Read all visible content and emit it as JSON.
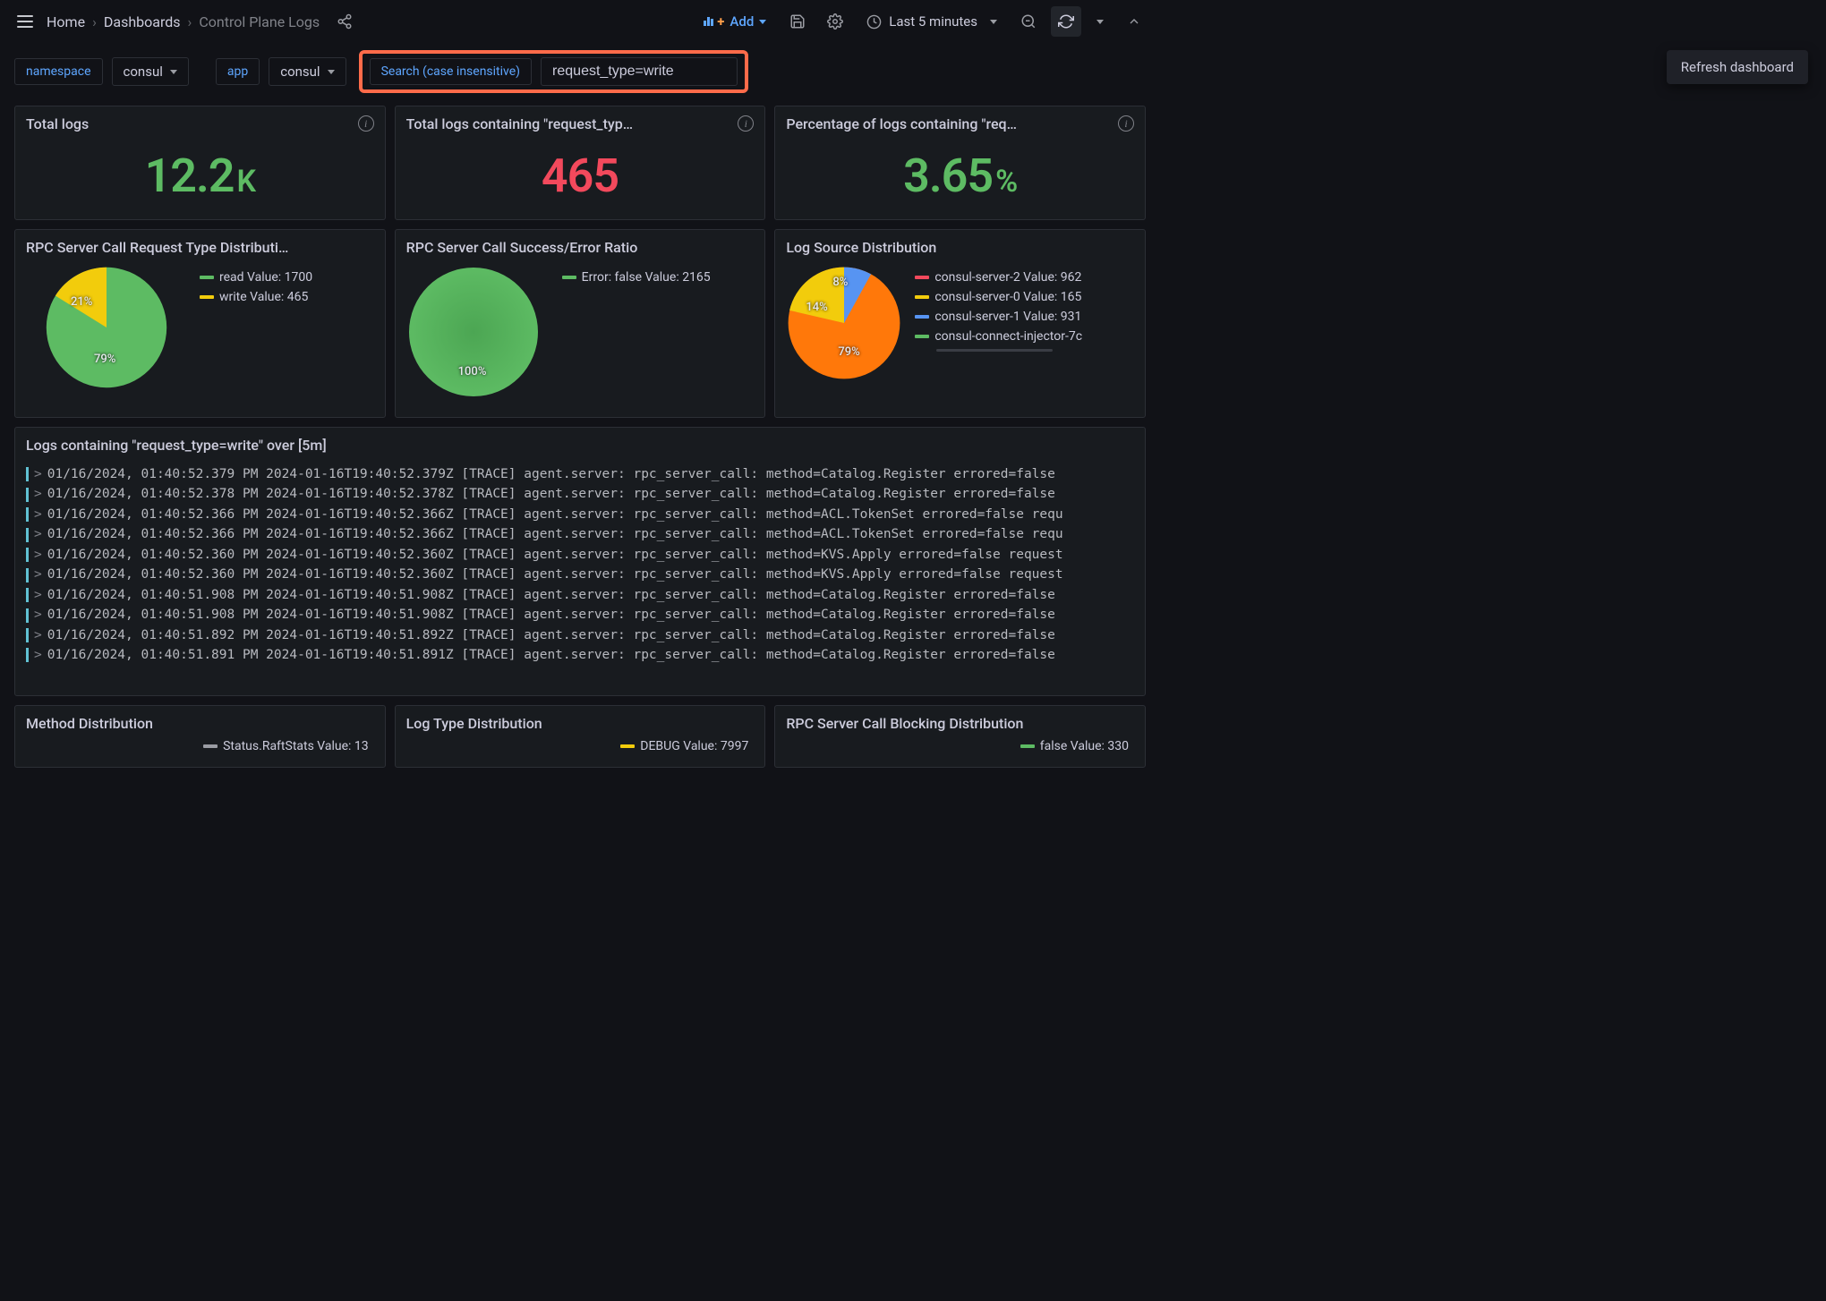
{
  "toolbar": {
    "breadcrumbs": [
      "Home",
      "Dashboards",
      "Control Plane Logs"
    ],
    "add_label": "Add",
    "time_label": "Last 5 minutes",
    "tooltip": "Refresh dashboard"
  },
  "filters": {
    "namespace_label": "namespace",
    "namespace_value": "consul",
    "app_label": "app",
    "app_value": "consul",
    "search_label": "Search (case insensitive)",
    "search_value": "request_type=write"
  },
  "panels": {
    "total_logs": {
      "title": "Total logs",
      "value": "12.2",
      "unit": "K"
    },
    "total_match": {
      "title": "Total logs containing \"request_typ…",
      "value": "465"
    },
    "percent_match": {
      "title": "Percentage of logs containing \"req…",
      "value": "3.65",
      "unit": "%"
    },
    "rpc_type": {
      "title": "RPC Server Call Request Type Distributi…",
      "legend": [
        {
          "color": "#5dbb63",
          "label": "read",
          "value": 1700
        },
        {
          "color": "#f2cc0c",
          "label": "write",
          "value": 465
        }
      ],
      "slice_labels": [
        "79%",
        "21%"
      ]
    },
    "rpc_success": {
      "title": "RPC Server Call Success/Error Ratio",
      "legend": [
        {
          "color": "#5dbb63",
          "label": "Error: false",
          "value": 2165
        }
      ],
      "slice_labels": [
        "100%"
      ]
    },
    "log_source": {
      "title": "Log Source Distribution",
      "legend": [
        {
          "color": "#f2495c",
          "label": "consul-server-2",
          "value": 962
        },
        {
          "color": "#f2cc0c",
          "label": "consul-server-0",
          "value": 165
        },
        {
          "color": "#5794f2",
          "label": "consul-server-1",
          "value": 931
        },
        {
          "color": "#5dbb63",
          "label": "consul-connect-injector-7c",
          "value": null
        }
      ],
      "slice_labels": [
        "79%",
        "14%",
        "8%"
      ]
    },
    "logs": {
      "title": "Logs containing \"request_type=write\" over [5m]",
      "rows": [
        "01/16/2024, 01:40:52.379 PM 2024-01-16T19:40:52.379Z [TRACE] agent.server: rpc_server_call: method=Catalog.Register errored=false",
        "01/16/2024, 01:40:52.378 PM 2024-01-16T19:40:52.378Z [TRACE] agent.server: rpc_server_call: method=Catalog.Register errored=false",
        "01/16/2024, 01:40:52.366 PM 2024-01-16T19:40:52.366Z [TRACE] agent.server: rpc_server_call: method=ACL.TokenSet errored=false requ",
        "01/16/2024, 01:40:52.366 PM 2024-01-16T19:40:52.366Z [TRACE] agent.server: rpc_server_call: method=ACL.TokenSet errored=false requ",
        "01/16/2024, 01:40:52.360 PM 2024-01-16T19:40:52.360Z [TRACE] agent.server: rpc_server_call: method=KVS.Apply errored=false request",
        "01/16/2024, 01:40:52.360 PM 2024-01-16T19:40:52.360Z [TRACE] agent.server: rpc_server_call: method=KVS.Apply errored=false request",
        "01/16/2024, 01:40:51.908 PM 2024-01-16T19:40:51.908Z [TRACE] agent.server: rpc_server_call: method=Catalog.Register errored=false",
        "01/16/2024, 01:40:51.908 PM 2024-01-16T19:40:51.908Z [TRACE] agent.server: rpc_server_call: method=Catalog.Register errored=false",
        "01/16/2024, 01:40:51.892 PM 2024-01-16T19:40:51.892Z [TRACE] agent.server: rpc_server_call: method=Catalog.Register errored=false",
        "01/16/2024, 01:40:51.891 PM 2024-01-16T19:40:51.891Z [TRACE] agent.server: rpc_server_call: method=Catalog.Register errored=false"
      ]
    },
    "method_dist": {
      "title": "Method Distribution",
      "legend": [
        {
          "color": "#9a9ca3",
          "label": "Status.RaftStats",
          "value": 13
        }
      ]
    },
    "logtype_dist": {
      "title": "Log Type Distribution",
      "legend": [
        {
          "color": "#f2cc0c",
          "label": "DEBUG",
          "value": 7997
        }
      ]
    },
    "blocking_dist": {
      "title": "RPC Server Call Blocking Distribution",
      "legend": [
        {
          "color": "#5dbb63",
          "label": "false",
          "value": 330
        }
      ]
    }
  },
  "chart_data": [
    {
      "type": "pie",
      "title": "RPC Server Call Request Type Distribution",
      "series": [
        {
          "name": "read",
          "value": 1700,
          "percent": 79
        },
        {
          "name": "write",
          "value": 465,
          "percent": 21
        }
      ]
    },
    {
      "type": "pie",
      "title": "RPC Server Call Success/Error Ratio",
      "series": [
        {
          "name": "Error: false",
          "value": 2165,
          "percent": 100
        }
      ]
    },
    {
      "type": "pie",
      "title": "Log Source Distribution",
      "series": [
        {
          "name": "consul-server-2",
          "value": 962,
          "percent": 79
        },
        {
          "name": "consul-server-0",
          "value": 165,
          "percent": 14
        },
        {
          "name": "consul-server-1",
          "value": 931,
          "percent": 8
        }
      ]
    }
  ]
}
